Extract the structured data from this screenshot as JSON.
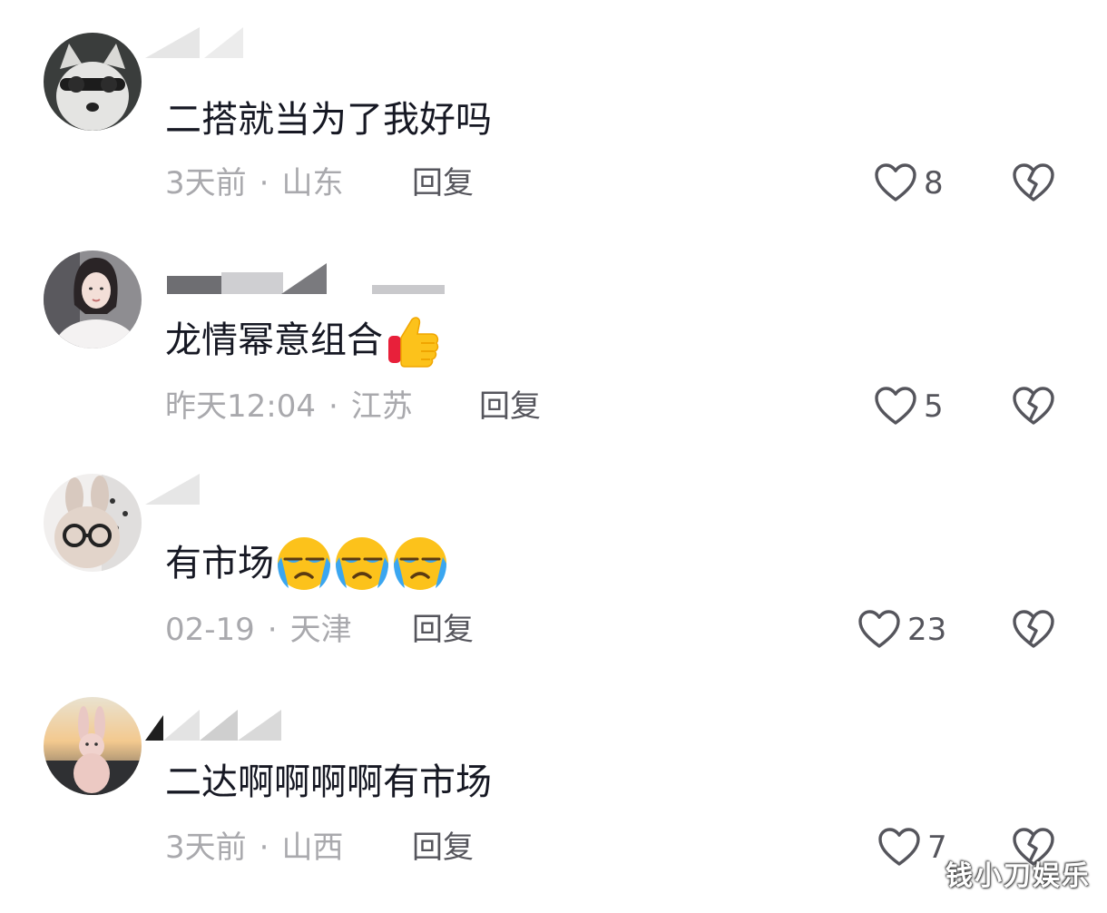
{
  "comments": [
    {
      "text": "二搭就当为了我好吗",
      "time": "3天前",
      "location": "山东",
      "reply_label": "回复",
      "likes": "8",
      "emoji": []
    },
    {
      "text": "龙情幂意组合",
      "time": "昨天12:04",
      "location": "江苏",
      "reply_label": "回复",
      "likes": "5",
      "emoji": [
        "thumbs-up"
      ]
    },
    {
      "text": "有市场",
      "time": "02-19",
      "location": "天津",
      "reply_label": "回复",
      "likes": "23",
      "emoji": [
        "crying-face",
        "crying-face",
        "crying-face"
      ]
    },
    {
      "text": "二达啊啊啊啊有市场",
      "time": "3天前",
      "location": "山西",
      "reply_label": "回复",
      "likes": "7",
      "emoji": []
    }
  ],
  "separator": "·",
  "watermark": "钱小刀娱乐",
  "colors": {
    "text": "#161823",
    "meta": "#a9a9ad",
    "icon": "#55555c"
  }
}
